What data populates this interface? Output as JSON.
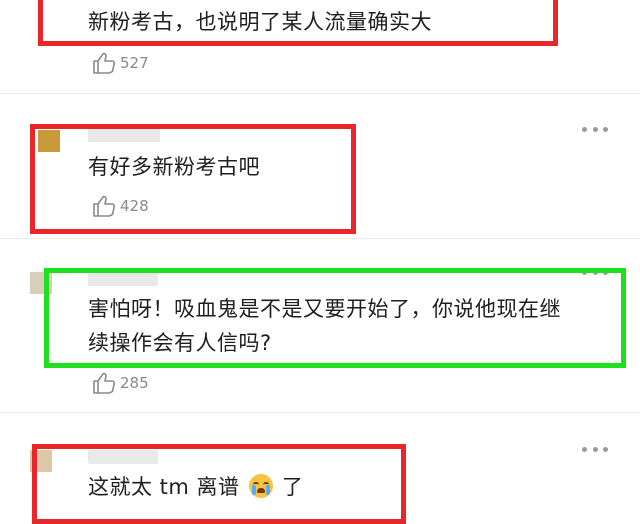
{
  "comments": [
    {
      "text": "新粉考古，也说明了某人流量确实大",
      "likes": "527"
    },
    {
      "text": "有好多新粉考古吧",
      "likes": "428"
    },
    {
      "text_line1": "害怕呀！吸血鬼是不是又要开始了，你说他现在继",
      "text_line2": "续操作会有人信吗?",
      "likes": "285"
    },
    {
      "text_part1": "这就太 tm 离谱",
      "emoji": "crying-emoji",
      "text_part2": "了"
    }
  ],
  "icons": {
    "like": "thumbs-up-icon",
    "more": "more-dots-icon"
  },
  "colors": {
    "red_box": "#e9262a",
    "green_box": "#1fe01f",
    "like_text": "#8a8a8a"
  }
}
